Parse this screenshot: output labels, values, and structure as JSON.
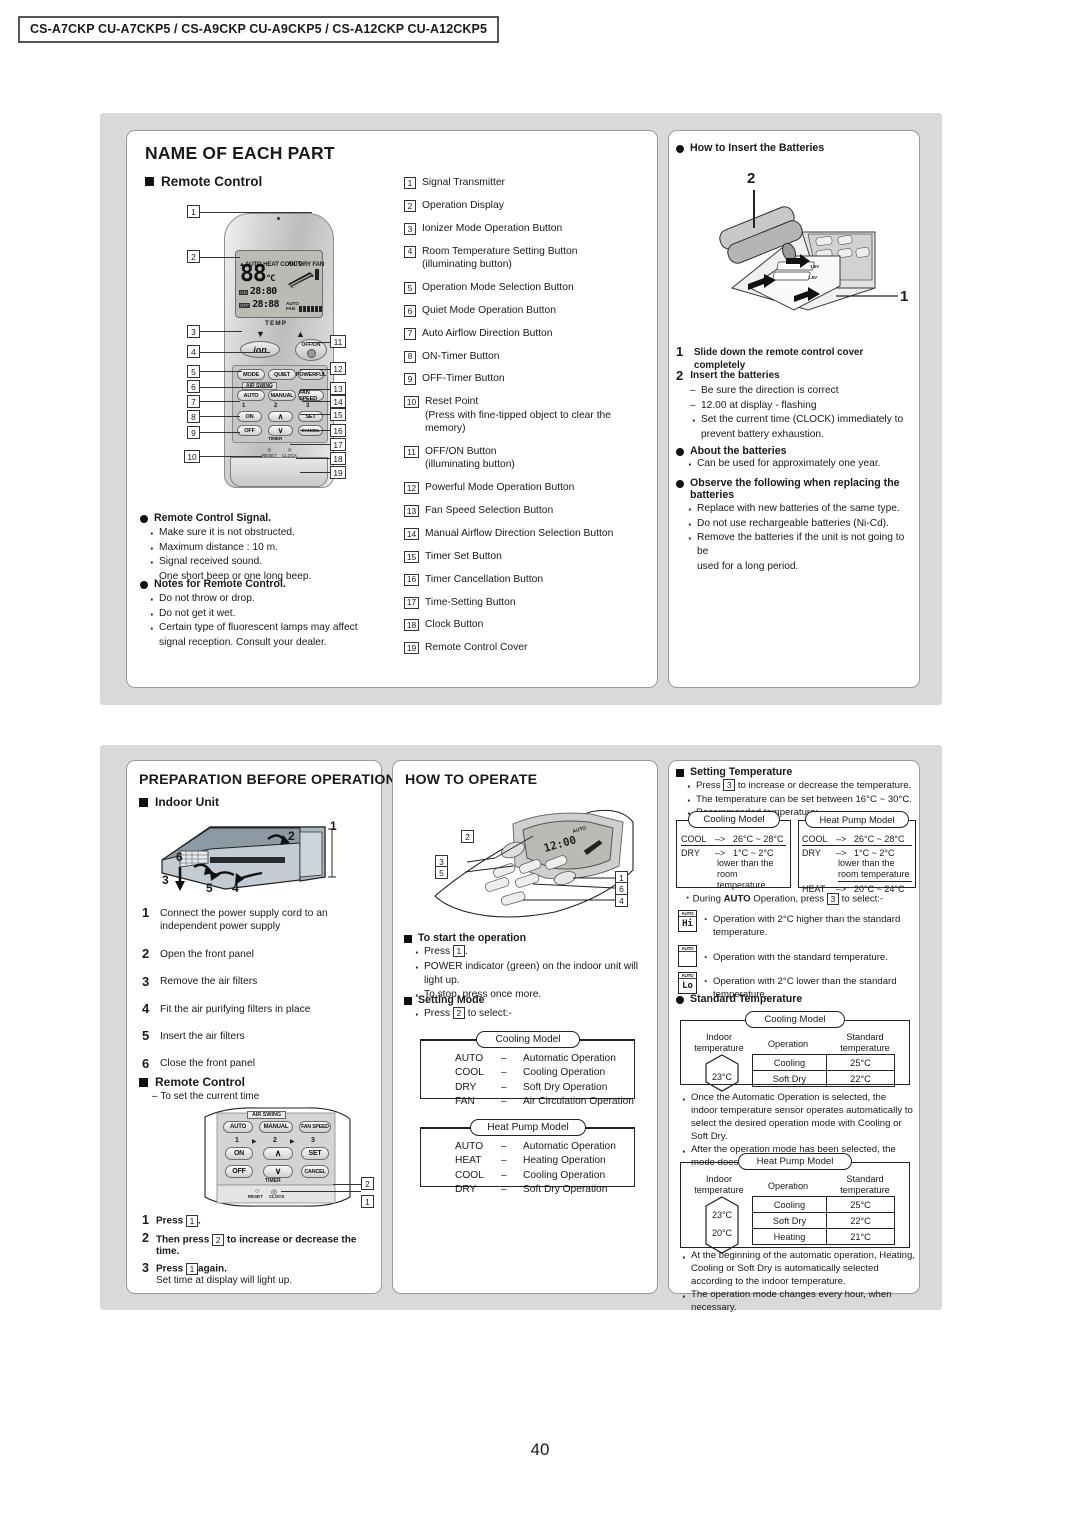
{
  "header": {
    "models": "CS-A7CKP CU-A7CKP5 / CS-A9CKP CU-A9CKP5 / CS-A12CKP CU-A12CKP5"
  },
  "page_number": "40",
  "section_name_of_each_part": {
    "title": "NAME OF EACH PART",
    "subhead_remote_control": "Remote Control",
    "parts": [
      {
        "n": "1",
        "label": "Signal Transmitter",
        "sub": ""
      },
      {
        "n": "2",
        "label": "Operation Display",
        "sub": ""
      },
      {
        "n": "3",
        "label": "Ionizer Mode Operation Button",
        "sub": ""
      },
      {
        "n": "4",
        "label": "Room Temperature Setting Button",
        "sub": "(illuminating button)"
      },
      {
        "n": "5",
        "label": "Operation Mode Selection Button",
        "sub": ""
      },
      {
        "n": "6",
        "label": "Quiet Mode Operation Button",
        "sub": ""
      },
      {
        "n": "7",
        "label": "Auto Airflow Direction Button",
        "sub": ""
      },
      {
        "n": "8",
        "label": "ON-Timer Button",
        "sub": ""
      },
      {
        "n": "9",
        "label": "OFF-Timer Button",
        "sub": ""
      },
      {
        "n": "10",
        "label": "Reset Point",
        "sub": "(Press with fine-tipped object to clear the memory)"
      },
      {
        "n": "11",
        "label": "OFF/ON Button",
        "sub": "(illuminating button)"
      },
      {
        "n": "12",
        "label": "Powerful Mode Operation Button",
        "sub": ""
      },
      {
        "n": "13",
        "label": "Fan Speed Selection Button",
        "sub": ""
      },
      {
        "n": "14",
        "label": "Manual Airflow Direction Selection Button",
        "sub": ""
      },
      {
        "n": "15",
        "label": "Timer Set Button",
        "sub": ""
      },
      {
        "n": "16",
        "label": "Timer Cancellation Button",
        "sub": ""
      },
      {
        "n": "17",
        "label": "Time-Setting Button",
        "sub": ""
      },
      {
        "n": "18",
        "label": "Clock Button",
        "sub": ""
      },
      {
        "n": "19",
        "label": "Remote Control Cover",
        "sub": ""
      }
    ],
    "signal_note": {
      "head": "Remote Control Signal.",
      "items": [
        "Make sure it is not obstructed.",
        "Maximum distance : 10 m.",
        "Signal received sound.",
        "One short beep or one long beep."
      ]
    },
    "notes": {
      "head": "Notes for Remote Control.",
      "items": [
        "Do not throw or drop.",
        "Do not get it wet.",
        "Certain type of fluorescent lamps may affect",
        "signal reception. Consult your dealer."
      ]
    }
  },
  "section_batteries": {
    "head": "How  to Insert the Batteries",
    "diagram_callouts": {
      "battery": "2",
      "cover": "1"
    },
    "step1": {
      "n": "1",
      "text": "Slide down the remote control cover completely"
    },
    "step2": {
      "n": "2",
      "title": "Insert the batteries",
      "items": [
        {
          "mark": "dash",
          "text": "Be sure the direction is correct"
        },
        {
          "mark": "dash",
          "text": "12.00 at display - flashing"
        },
        {
          "mark": "dot",
          "text": "Set the current time (CLOCK) immediately to"
        },
        {
          "mark": "none",
          "text": "prevent battery exhaustion."
        }
      ]
    },
    "about": {
      "head": "About the batteries",
      "items": [
        "Can be used for approximately one year."
      ]
    },
    "observe": {
      "head": "Observe the following when replacing the batteries",
      "items": [
        "Replace with new batteries of the same type.",
        "Do not use rechargeable batteries (Ni-Cd).",
        "Remove the batteries if the unit is not going to be",
        "used for a long period."
      ]
    },
    "battery_labels": {
      "v1": "1.5V",
      "v2": "1.5V"
    }
  },
  "section_preparation": {
    "title": "PREPARATION BEFORE OPERATION",
    "subhead_indoor_unit": "Indoor Unit",
    "indoor_callouts": [
      "1",
      "2",
      "3",
      "4",
      "5",
      "6"
    ],
    "steps": [
      {
        "n": "1",
        "text": "Connect the power supply cord to an independent power supply"
      },
      {
        "n": "2",
        "text": "Open the front panel"
      },
      {
        "n": "3",
        "text": "Remove the air filters"
      },
      {
        "n": "4",
        "text": "Fit the air purifying filters in place"
      },
      {
        "n": "5",
        "text": "Insert the air filters"
      },
      {
        "n": "6",
        "text": "Close the front panel"
      }
    ],
    "subhead_remote_control": "Remote Control",
    "remote_note": "To set the current time",
    "remote_callouts": [
      "1",
      "2"
    ],
    "clock_steps": [
      {
        "n": "1",
        "bold": "Press",
        "box": "1",
        "after": ".",
        "sub": ""
      },
      {
        "n": "2",
        "bold": "Then press",
        "box": "2",
        "after": "to increase or decrease the time.",
        "sub": ""
      },
      {
        "n": "3",
        "bold": "Press",
        "box": "1",
        "after": "again.",
        "sub": "Set time at display will light up."
      }
    ],
    "remote_buttons": {
      "air_swing": "AIR SWING",
      "auto": "AUTO",
      "manual": "MANUAL",
      "fan_speed": "FAN SPEED",
      "n1": "1",
      "n2": "2",
      "n3": "3",
      "on": "ON",
      "set": "SET",
      "off": "OFF",
      "cancel": "CANCEL",
      "timer": "TIMER",
      "reset": "RESET",
      "clock": "CLOCK"
    }
  },
  "section_how_to_operate": {
    "title": "HOW TO OPERATE",
    "diagram_callouts": [
      "1",
      "2",
      "3",
      "4",
      "5",
      "6"
    ],
    "start": {
      "head": "To start the operation",
      "items": [
        {
          "pre": "Press",
          "box": "1",
          "post": "."
        },
        {
          "pre": "POWER indicator (green) on the indoor unit will light up.",
          "box": "",
          "post": ""
        },
        {
          "pre": "To stop, press once more.",
          "box": "",
          "post": ""
        }
      ]
    },
    "setting_mode": {
      "head": "Setting Mode",
      "press_pre": "Press",
      "press_box": "2",
      "press_post": "to select:-",
      "cooling_model": {
        "tab": "Cooling Model",
        "rows": [
          {
            "mode": "AUTO",
            "dash": "–",
            "desc": "Automatic Operation"
          },
          {
            "mode": "COOL",
            "dash": "–",
            "desc": "Cooling Operation"
          },
          {
            "mode": "DRY",
            "dash": "–",
            "desc": "Soft Dry Operation"
          },
          {
            "mode": "FAN",
            "dash": "–",
            "desc": "Air Circulation Operation"
          }
        ]
      },
      "heat_pump_model": {
        "tab": "Heat Pump Model",
        "rows": [
          {
            "mode": "AUTO",
            "dash": "–",
            "desc": "Automatic Operation"
          },
          {
            "mode": "HEAT",
            "dash": "–",
            "desc": "Heating Operation"
          },
          {
            "mode": "COOL",
            "dash": "–",
            "desc": "Cooling Operation"
          },
          {
            "mode": "DRY",
            "dash": "–",
            "desc": "Soft Dry Operation"
          }
        ]
      }
    }
  },
  "section_setting_temperature": {
    "head": "Setting Temperature",
    "bullets": [
      {
        "pre": "Press",
        "box": "3",
        "post": "to increase or decrease the temperature."
      },
      {
        "pre": "The temperature can be set between 16°C ~ 30°C.",
        "box": "",
        "post": ""
      },
      {
        "pre": "Recommended temperature:",
        "box": "",
        "post": ""
      }
    ],
    "cooling_box": {
      "tab": "Cooling Model",
      "rows": [
        {
          "mode": "COOL",
          "arrow": "–>",
          "val": "26°C ~ 28°C",
          "extra": ""
        },
        {
          "mode": "DRY",
          "arrow": "–>",
          "val": "1°C ~  2°C",
          "extra": "lower than the room temperature"
        }
      ]
    },
    "heatpump_box": {
      "tab": "Heat Pump Model",
      "rows": [
        {
          "mode": "COOL",
          "arrow": "–>",
          "val": "26°C ~ 28°C",
          "extra": ""
        },
        {
          "mode": "DRY",
          "arrow": "–>",
          "val": "1°C ~  2°C",
          "extra": "lower than the room temperature"
        },
        {
          "mode": "HEAT",
          "arrow": "–>",
          "val": "20°C ~ 24°C",
          "extra": ""
        }
      ]
    },
    "auto_line": {
      "pre": "During",
      "bold": "AUTO",
      "mid": "Operation, press",
      "box": "3",
      "post": "to select:-"
    },
    "auto_options": [
      {
        "icon_top": "AUTO",
        "icon_val": "Hi",
        "text": "Operation with 2°C higher than the standard temperature."
      },
      {
        "icon_top": "AUTO",
        "icon_val": "",
        "text": "Operation with the standard temperature."
      },
      {
        "icon_top": "AUTO",
        "icon_val": "Lo",
        "text": "Operation with 2°C lower than the standard temperature."
      }
    ]
  },
  "section_standard_temperature": {
    "head": "Standard Temperature",
    "cooling": {
      "tab": "Cooling Model",
      "col_indoor": "Indoor temperature",
      "col_operation": "Operation",
      "col_standard": "Standard temperature",
      "indoor_values": [
        "23°C"
      ],
      "rows": [
        {
          "operation": "Cooling",
          "standard": "25°C"
        },
        {
          "operation": "Soft Dry",
          "standard": "22°C"
        }
      ]
    },
    "cooling_notes": [
      "Once the Automatic Operation is selected, the indoor temperature sensor operates automatically to select the desired operation mode with Cooling or Soft Dry.",
      "After the operation mode has been selected, the mode does not change."
    ],
    "heatpump": {
      "tab": "Heat Pump Model",
      "col_indoor": "Indoor temperature",
      "col_operation": "Operation",
      "col_standard": "Standard temperature",
      "indoor_values": [
        "23°C",
        "20°C"
      ],
      "rows": [
        {
          "operation": "Cooling",
          "standard": "25°C"
        },
        {
          "operation": "Soft Dry",
          "standard": "22°C"
        },
        {
          "operation": "Heating",
          "standard": "21°C"
        }
      ]
    },
    "heatpump_notes": [
      "At the beginning of the automatic operation, Heating, Cooling or Soft Dry is automatically selected according to the indoor temperature.",
      "The operation mode changes every hour, when necessary."
    ]
  },
  "remote_display": {
    "modes": "AUTO HEAT COOL DRY FAN",
    "temp": "88",
    "unit": "°C",
    "on_time": "28:80",
    "off_time": "28:88",
    "auto_label": "AUTO",
    "fan_label": "AUTO FAN",
    "temp_label": "TEMP"
  },
  "remote_buttons_main": {
    "ion": "ion",
    "offon": "OFF/ON",
    "mode": "MODE",
    "quiet": "QUIET",
    "powerful": "POWERFUL",
    "air_swing": "AIR SWING",
    "auto": "AUTO",
    "manual": "MANUAL",
    "fan_speed": "FAN SPEED",
    "n1": "1",
    "n2": "2",
    "n3": "3",
    "on": "ON",
    "off": "OFF",
    "set": "SET",
    "cancel": "CANCEL",
    "timer": "TIMER",
    "reset": "RESET",
    "clock": "CLOCK"
  }
}
